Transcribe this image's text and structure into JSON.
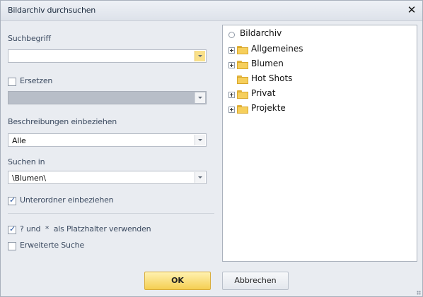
{
  "window": {
    "title": "Bildarchiv durchsuchen"
  },
  "form": {
    "search_label": "Suchbegriff",
    "search_value": "",
    "replace_label": "Ersetzen",
    "replace_checked": false,
    "replace_value": "",
    "descriptions_label": "Beschreibungen einbeziehen",
    "descriptions_value": "Alle",
    "search_in_label": "Suchen in",
    "search_in_value": "\\Blumen\\",
    "subfolders_label": "Unterordner einbeziehen",
    "subfolders_checked": true,
    "wildcards_label_prefix": "?",
    "wildcards_label_and": "und",
    "wildcards_label_star": "*",
    "wildcards_label_suffix": "als Platzhalter verwenden",
    "wildcards_checked": true,
    "advanced_label": "Erweiterte Suche",
    "advanced_checked": false
  },
  "tree": {
    "root": "Bildarchiv",
    "items": [
      {
        "label": "Allgemeines",
        "expandable": true
      },
      {
        "label": "Blumen",
        "expandable": true
      },
      {
        "label": "Hot Shots",
        "expandable": false
      },
      {
        "label": "Privat",
        "expandable": true
      },
      {
        "label": "Projekte",
        "expandable": true
      }
    ]
  },
  "buttons": {
    "ok": "OK",
    "cancel": "Abbrechen"
  },
  "colors": {
    "accent": "#f5cf52",
    "panel": "#e9ecf1",
    "folder": "#f6cf5c"
  },
  "icons": {
    "close": "close-icon",
    "folder": "folder-icon",
    "expander": "tree-expand-icon",
    "root": "radio-icon"
  }
}
